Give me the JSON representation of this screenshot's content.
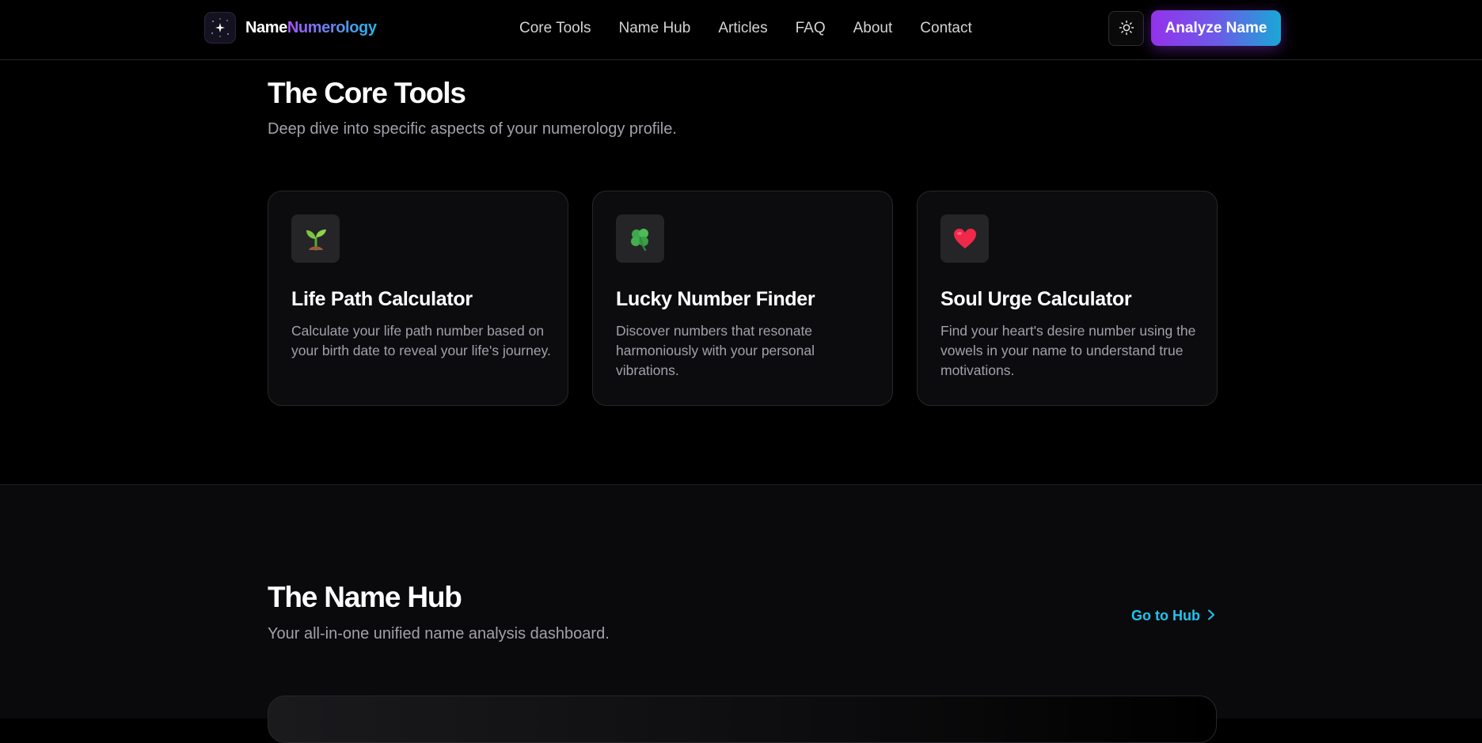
{
  "header": {
    "logo": {
      "word1": "Name",
      "word2": "Numerology",
      "icon": "sparkle-icon"
    },
    "nav": [
      {
        "label": "Core Tools"
      },
      {
        "label": "Name Hub"
      },
      {
        "label": "Articles"
      },
      {
        "label": "FAQ"
      },
      {
        "label": "About"
      },
      {
        "label": "Contact"
      }
    ],
    "theme_toggle_icon": "sun-icon",
    "cta_label": "Analyze Name"
  },
  "core_tools": {
    "title": "The Core Tools",
    "subtitle": "Deep dive into specific aspects of your numerology profile.",
    "cards": [
      {
        "icon": "seedling-icon",
        "title": "Life Path Calculator",
        "description": "Calculate your life path number based on your birth date to reveal your life's journey."
      },
      {
        "icon": "four-leaf-clover-icon",
        "title": "Lucky Number Finder",
        "description": "Discover numbers that resonate harmoniously with your personal vibrations."
      },
      {
        "icon": "heart-icon",
        "title": "Soul Urge Calculator",
        "description": "Find your heart's desire number using the vowels in your name to understand true motivations."
      }
    ]
  },
  "name_hub": {
    "title": "The Name Hub",
    "subtitle": "Your all-in-one unified name analysis dashboard.",
    "link_label": "Go to Hub"
  },
  "colors": {
    "background": "#000000",
    "accent_purple": "#9333ea",
    "accent_cyan": "#22c3ee"
  }
}
